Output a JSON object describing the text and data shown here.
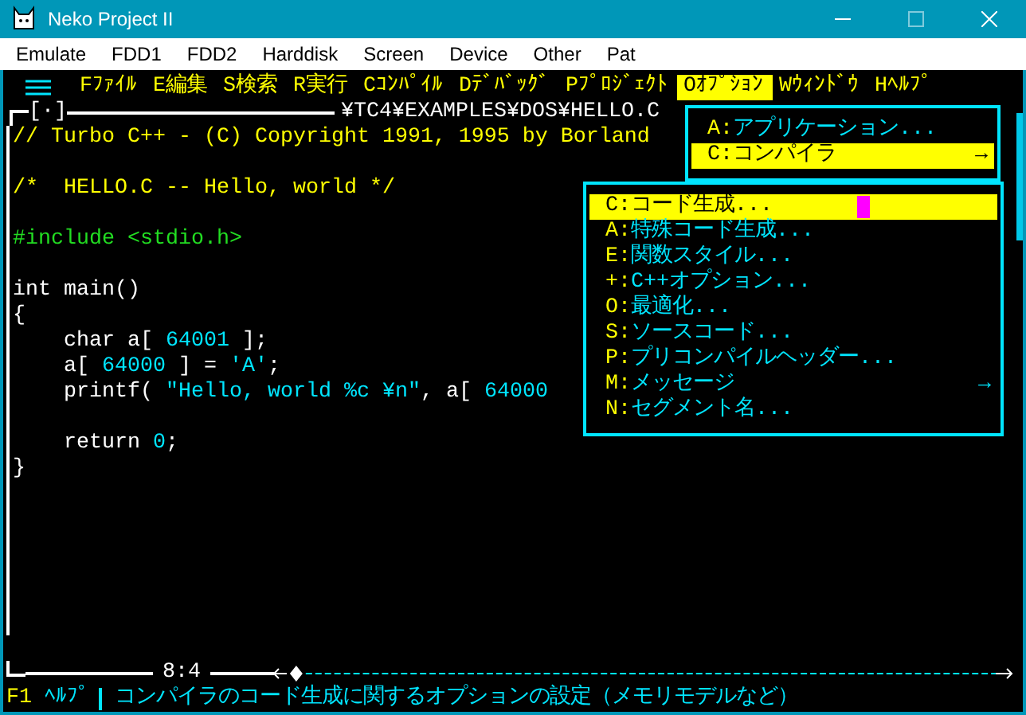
{
  "window": {
    "title": "Neko Project II"
  },
  "menu_bar": [
    "Emulate",
    "FDD1",
    "FDD2",
    "Harddisk",
    "Screen",
    "Device",
    "Other",
    "Pat"
  ],
  "ide_menu": [
    {
      "key": "F",
      "label": "ﾌｧｲﾙ",
      "selected": false
    },
    {
      "key": "E",
      "label": "編集",
      "selected": false
    },
    {
      "key": "S",
      "label": "検索",
      "selected": false
    },
    {
      "key": "R",
      "label": "実行",
      "selected": false
    },
    {
      "key": "C",
      "label": "ｺﾝﾊﾟｲﾙ",
      "selected": false
    },
    {
      "key": "D",
      "label": "ﾃﾞﾊﾞｯｸﾞ",
      "selected": false
    },
    {
      "key": "P",
      "label": "ﾌﾟﾛｼﾞｪｸﾄ",
      "selected": false
    },
    {
      "key": "O",
      "label": "ｵﾌﾟｼｮﾝ",
      "selected": true
    },
    {
      "key": "W",
      "label": "ｳｨﾝﾄﾞｳ",
      "selected": false
    },
    {
      "key": "H",
      "label": "ﾍﾙﾌﾟ",
      "selected": false
    }
  ],
  "editor": {
    "close_box": "[·]",
    "file_path": "¥TC4¥EXAMPLES¥DOS¥HELLO.C",
    "cursor_position": "8:4",
    "blocks": [
      [
        [
          {
            "kind": "comment",
            "text": "// Turbo C++ - (C) Copyright 1991, 1995 by Borland"
          }
        ]
      ],
      [
        [
          {
            "kind": "comment",
            "text": "/*  HELLO.C -- Hello, world */"
          }
        ]
      ],
      [
        [
          {
            "kind": "directive",
            "text": "#include <stdio.h>"
          }
        ]
      ],
      [
        [
          {
            "kind": "plain",
            "text": "int main()"
          }
        ],
        [
          {
            "kind": "plain",
            "text": "{"
          }
        ],
        [
          {
            "kind": "plain",
            "text": "    char a[ "
          },
          {
            "kind": "number",
            "text": "64001"
          },
          {
            "kind": "plain",
            "text": " ];"
          }
        ],
        [
          {
            "kind": "plain",
            "text": "    a[ "
          },
          {
            "kind": "number",
            "text": "64000"
          },
          {
            "kind": "plain",
            "text": " ] = "
          },
          {
            "kind": "string",
            "text": "'A'"
          },
          {
            "kind": "plain",
            "text": ";"
          }
        ],
        [
          {
            "kind": "plain",
            "text": "    printf( "
          },
          {
            "kind": "string",
            "text": "\"Hello, world %c ¥n\""
          },
          {
            "kind": "plain",
            "text": ", a[ "
          },
          {
            "kind": "number",
            "text": "64000"
          }
        ]
      ],
      [
        [
          {
            "kind": "plain",
            "text": "    return "
          },
          {
            "kind": "number",
            "text": "0"
          },
          {
            "kind": "plain",
            "text": ";"
          }
        ],
        [
          {
            "kind": "plain",
            "text": "}"
          }
        ]
      ]
    ]
  },
  "options_menu": [
    {
      "key": "A:",
      "label": "アプリケーション...",
      "selected": false
    },
    {
      "key": "C:",
      "label": "コンパイラ",
      "selected": true,
      "arrow": "→"
    }
  ],
  "compiler_menu": [
    {
      "key": "C:",
      "label": "コード生成...",
      "selected": true
    },
    {
      "key": "A:",
      "label": "特殊コード生成...",
      "selected": false
    },
    {
      "key": "E:",
      "label": "関数スタイル...",
      "selected": false
    },
    {
      "key": "+:",
      "label": "C++オプション...",
      "selected": false
    },
    {
      "key": "O:",
      "label": "最適化...",
      "selected": false
    },
    {
      "key": "S:",
      "label": "ソースコード...",
      "selected": false
    },
    {
      "key": "P:",
      "label": "プリコンパイルヘッダー...",
      "selected": false
    },
    {
      "key": "M:",
      "label": "メッセージ",
      "selected": false,
      "arrow": "→"
    },
    {
      "key": "N:",
      "label": "セグメント名...",
      "selected": false
    }
  ],
  "status_bar": {
    "key": "F1",
    "label": "ﾍﾙﾌﾟ",
    "message": "コンパイラのコード生成に関するオプションの設定（メモリモデルなど）"
  }
}
